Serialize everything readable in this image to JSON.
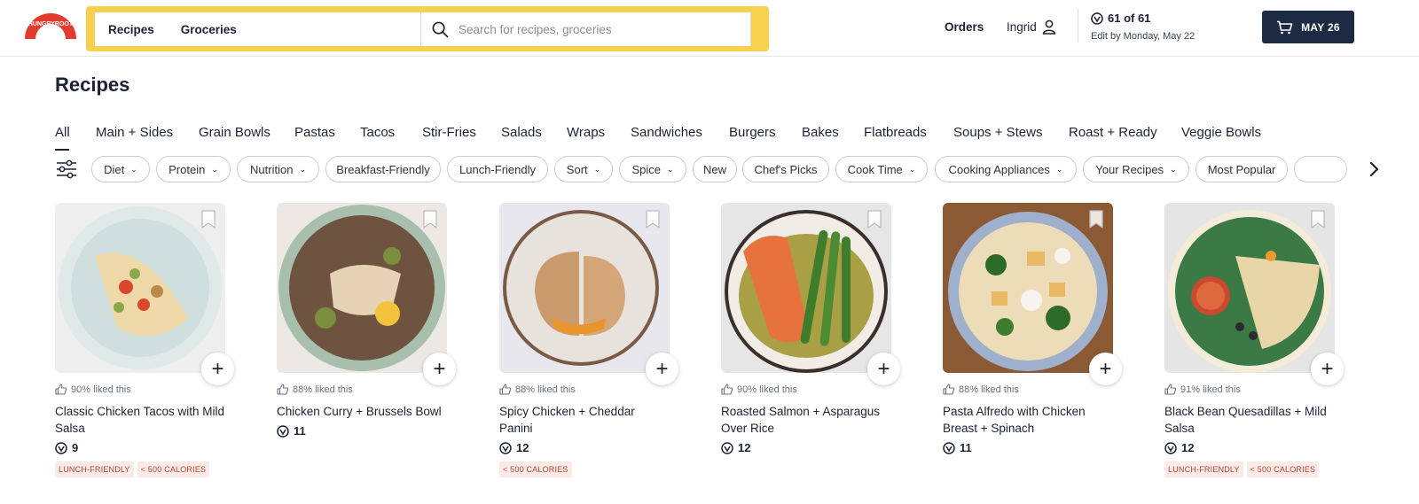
{
  "brand": {
    "name": "HUNGRYROOT",
    "accent": "#e23b2e",
    "search_highlight": "#f7d14d",
    "dark": "#1c2a44"
  },
  "header": {
    "nav": [
      "Recipes",
      "Groceries"
    ],
    "search_placeholder": "Search for recipes, groceries",
    "orders": "Orders",
    "user": "Ingrid",
    "points": "61 of 61",
    "edit_by": "Edit by Monday, May 22",
    "cart_label": "MAY 26"
  },
  "page_title": "Recipes",
  "categories": [
    "All",
    "Main + Sides",
    "Grain Bowls",
    "Pastas",
    "Tacos",
    "Stir-Fries",
    "Salads",
    "Wraps",
    "Sandwiches",
    "Burgers",
    "Bakes",
    "Flatbreads",
    "Soups + Stews",
    "Roast + Ready",
    "Veggie Bowls"
  ],
  "active_category": "All",
  "filters": [
    {
      "label": "Diet",
      "dropdown": true
    },
    {
      "label": "Protein",
      "dropdown": true
    },
    {
      "label": "Nutrition",
      "dropdown": true
    },
    {
      "label": "Breakfast-Friendly",
      "dropdown": false
    },
    {
      "label": "Lunch-Friendly",
      "dropdown": false
    },
    {
      "label": "Sort",
      "dropdown": true
    },
    {
      "label": "Spice",
      "dropdown": true
    },
    {
      "label": "New",
      "dropdown": false
    },
    {
      "label": "Chef's Picks",
      "dropdown": false
    },
    {
      "label": "Cook Time",
      "dropdown": true
    },
    {
      "label": "Cooking Appliances",
      "dropdown": true
    },
    {
      "label": "Your Recipes",
      "dropdown": true
    },
    {
      "label": "Most Popular",
      "dropdown": false
    }
  ],
  "recipes": [
    {
      "liked": "90% liked this",
      "name": "Classic Chicken Tacos with Mild Salsa",
      "points": "9",
      "tags": [
        "LUNCH-FRIENDLY",
        "< 500 CALORIES"
      ],
      "plate": "#dfe9e8",
      "bg": "#eeeeee"
    },
    {
      "liked": "88% liked this",
      "name": "Chicken Curry + Brussels Bowl",
      "points": "11",
      "tags": [],
      "plate": "#a9bfae",
      "bg": "#ece9e4"
    },
    {
      "liked": "88% liked this",
      "name": "Spicy Chicken + Cheddar Panini",
      "points": "12",
      "tags": [
        "< 500 CALORIES"
      ],
      "plate": "#e7e2dc",
      "bg": "#e8e7ee"
    },
    {
      "liked": "90% liked this",
      "name": "Roasted Salmon + Asparagus Over Rice",
      "points": "12",
      "tags": [],
      "plate": "#f1ede6",
      "bg": "#e7e6e6"
    },
    {
      "liked": "88% liked this",
      "name": "Pasta Alfredo with Chicken Breast + Spinach",
      "points": "11",
      "tags": [],
      "plate": "#9fb0cc",
      "bg": "#8b5a35"
    },
    {
      "liked": "91% liked this",
      "name": "Black Bean Quesadillas + Mild Salsa",
      "points": "12",
      "tags": [
        "LUNCH-FRIENDLY",
        "< 500 CALORIES"
      ],
      "plate": "#3b7a45",
      "bg": "#e5e5e5"
    }
  ]
}
